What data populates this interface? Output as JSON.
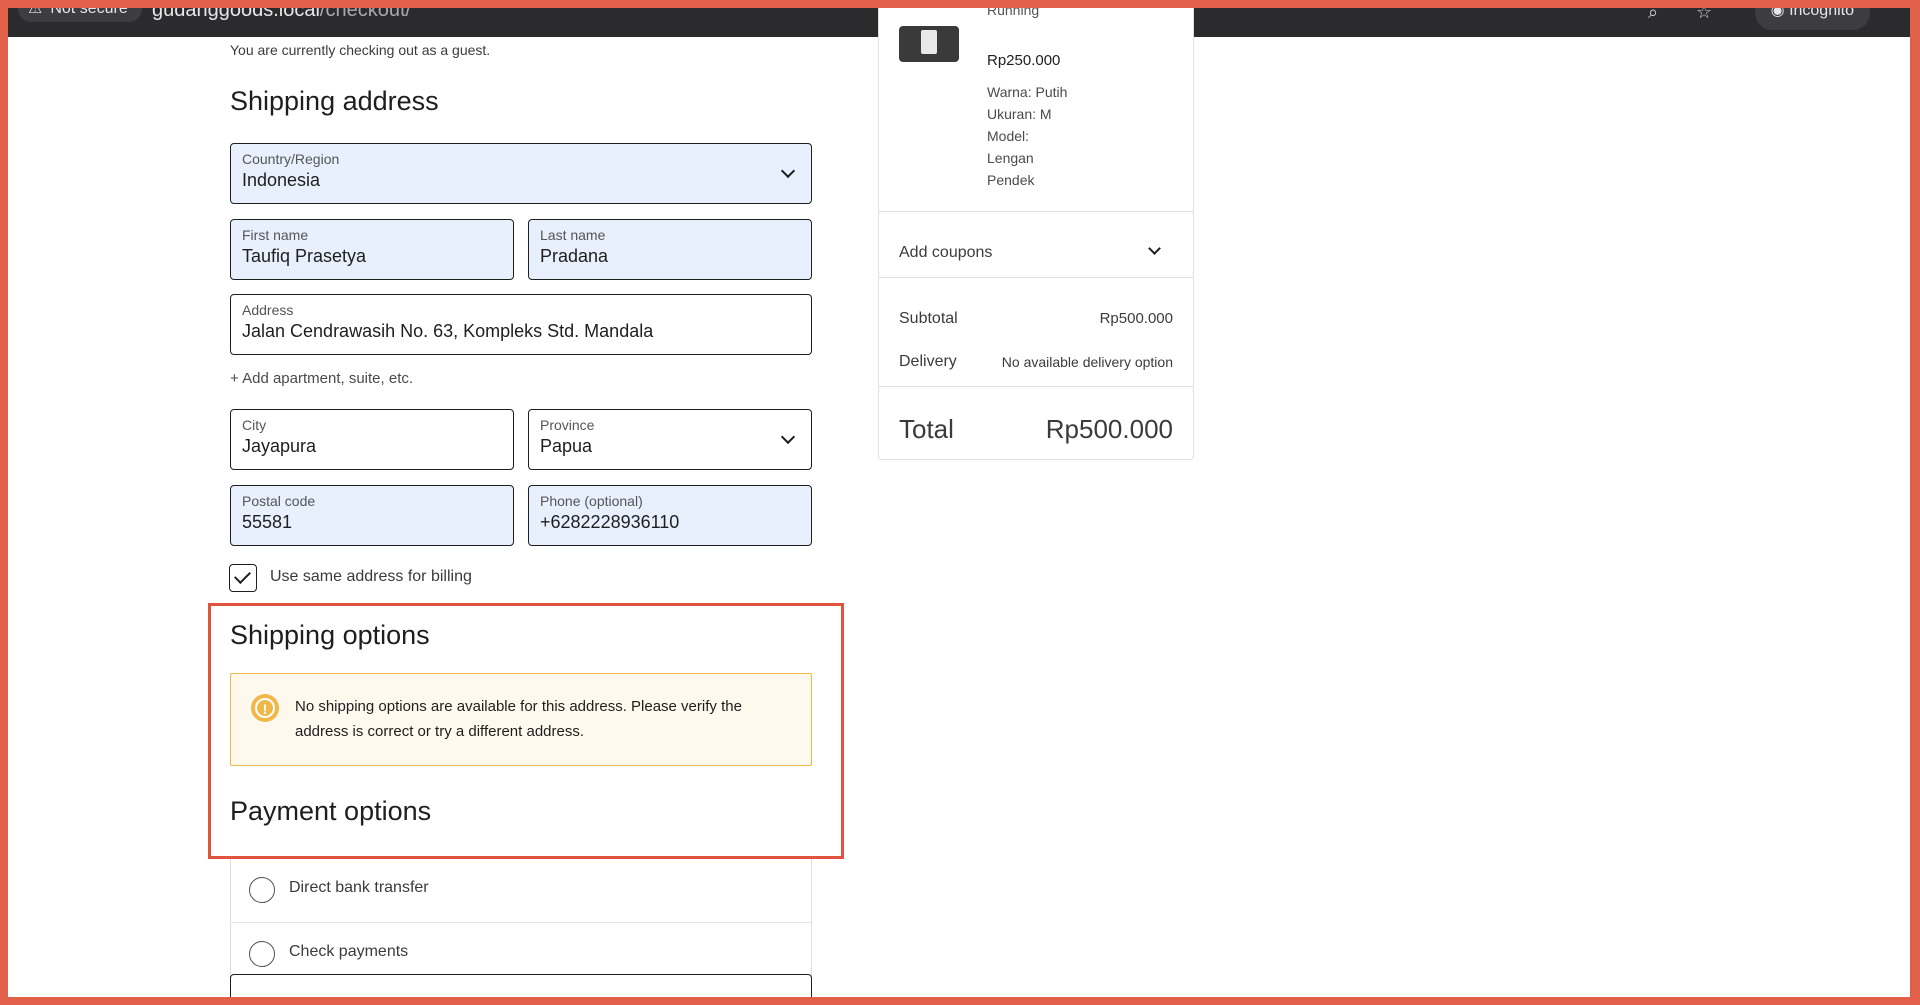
{
  "browser": {
    "security_label": "Not secure",
    "url_host": "gudanggoods.local",
    "url_path": "/checkout/",
    "incognito_label": "Incognito"
  },
  "checkout": {
    "guest_notice": "You are currently checking out as a guest.",
    "shipping_address": {
      "heading": "Shipping address",
      "country": {
        "label": "Country/Region",
        "value": "Indonesia"
      },
      "first_name": {
        "label": "First name",
        "value": "Taufiq Prasetya"
      },
      "last_name": {
        "label": "Last name",
        "value": "Pradana"
      },
      "address": {
        "label": "Address",
        "value": "Jalan Cendrawasih No. 63, Kompleks Std. Mandala"
      },
      "add_apartment": "+ Add apartment, suite, etc.",
      "city": {
        "label": "City",
        "value": "Jayapura"
      },
      "province": {
        "label": "Province",
        "value": "Papua"
      },
      "postal_code": {
        "label": "Postal code",
        "value": "55581"
      },
      "phone": {
        "label": "Phone (optional)",
        "value": "+6282228936110"
      },
      "same_billing": {
        "label": "Use same address for billing",
        "checked": true
      }
    },
    "shipping_options": {
      "heading": "Shipping options",
      "notice": "No shipping options are available for this address. Please verify the address is correct or try a different address."
    },
    "payment_options": {
      "heading": "Payment options",
      "methods": [
        "Direct bank transfer",
        "Check payments"
      ]
    }
  },
  "summary": {
    "product": {
      "name_fragment": "Running",
      "price": "Rp250.000",
      "attributes": [
        "Warna: Putih",
        "Ukuran: M",
        "Model:",
        "Lengan",
        "Pendek"
      ]
    },
    "coupons_label": "Add coupons",
    "subtotal_label": "Subtotal",
    "subtotal_value": "Rp500.000",
    "delivery_label": "Delivery",
    "delivery_value": "No available delivery option",
    "total_label": "Total",
    "total_value": "Rp500.000"
  },
  "colors": {
    "highlight": "#e0533c",
    "autofill": "#e8f0fe",
    "warning": "#f0b849",
    "warning_bg": "#fff9ed"
  }
}
